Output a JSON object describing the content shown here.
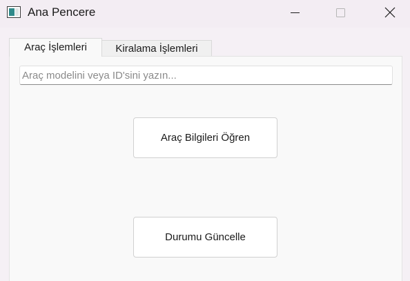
{
  "window": {
    "title": "Ana Pencere",
    "icon": "window-app-icon",
    "controls": [
      "minimize-icon",
      "maximize-icon",
      "close-icon"
    ]
  },
  "tabs": [
    {
      "label": "Araç İşlemleri",
      "active": true
    },
    {
      "label": "Kiralama İşlemleri",
      "active": false
    }
  ],
  "search": {
    "value": "",
    "placeholder": "Araç modelini veya ID'sini yazın..."
  },
  "buttons": {
    "info_label": "Araç Bilgileri Öğren",
    "update_label": "Durumu Güncelle"
  }
}
